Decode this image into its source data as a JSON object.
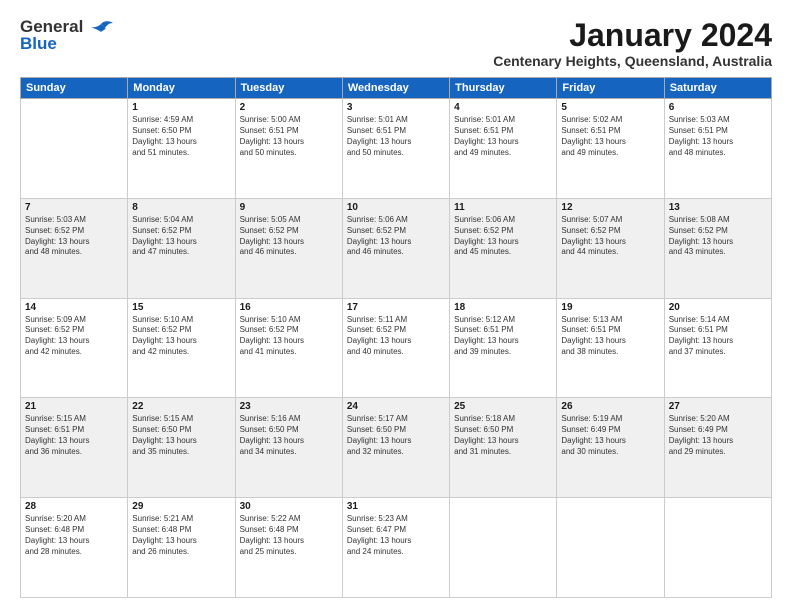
{
  "header": {
    "logo_general": "General",
    "logo_blue": "Blue",
    "title": "January 2024",
    "subtitle": "Centenary Heights, Queensland, Australia"
  },
  "days_of_week": [
    "Sunday",
    "Monday",
    "Tuesday",
    "Wednesday",
    "Thursday",
    "Friday",
    "Saturday"
  ],
  "weeks": [
    {
      "shaded": false,
      "days": [
        {
          "date": "",
          "info": ""
        },
        {
          "date": "1",
          "info": "Sunrise: 4:59 AM\nSunset: 6:50 PM\nDaylight: 13 hours\nand 51 minutes."
        },
        {
          "date": "2",
          "info": "Sunrise: 5:00 AM\nSunset: 6:51 PM\nDaylight: 13 hours\nand 50 minutes."
        },
        {
          "date": "3",
          "info": "Sunrise: 5:01 AM\nSunset: 6:51 PM\nDaylight: 13 hours\nand 50 minutes."
        },
        {
          "date": "4",
          "info": "Sunrise: 5:01 AM\nSunset: 6:51 PM\nDaylight: 13 hours\nand 49 minutes."
        },
        {
          "date": "5",
          "info": "Sunrise: 5:02 AM\nSunset: 6:51 PM\nDaylight: 13 hours\nand 49 minutes."
        },
        {
          "date": "6",
          "info": "Sunrise: 5:03 AM\nSunset: 6:51 PM\nDaylight: 13 hours\nand 48 minutes."
        }
      ]
    },
    {
      "shaded": true,
      "days": [
        {
          "date": "7",
          "info": "Sunrise: 5:03 AM\nSunset: 6:52 PM\nDaylight: 13 hours\nand 48 minutes."
        },
        {
          "date": "8",
          "info": "Sunrise: 5:04 AM\nSunset: 6:52 PM\nDaylight: 13 hours\nand 47 minutes."
        },
        {
          "date": "9",
          "info": "Sunrise: 5:05 AM\nSunset: 6:52 PM\nDaylight: 13 hours\nand 46 minutes."
        },
        {
          "date": "10",
          "info": "Sunrise: 5:06 AM\nSunset: 6:52 PM\nDaylight: 13 hours\nand 46 minutes."
        },
        {
          "date": "11",
          "info": "Sunrise: 5:06 AM\nSunset: 6:52 PM\nDaylight: 13 hours\nand 45 minutes."
        },
        {
          "date": "12",
          "info": "Sunrise: 5:07 AM\nSunset: 6:52 PM\nDaylight: 13 hours\nand 44 minutes."
        },
        {
          "date": "13",
          "info": "Sunrise: 5:08 AM\nSunset: 6:52 PM\nDaylight: 13 hours\nand 43 minutes."
        }
      ]
    },
    {
      "shaded": false,
      "days": [
        {
          "date": "14",
          "info": "Sunrise: 5:09 AM\nSunset: 6:52 PM\nDaylight: 13 hours\nand 42 minutes."
        },
        {
          "date": "15",
          "info": "Sunrise: 5:10 AM\nSunset: 6:52 PM\nDaylight: 13 hours\nand 42 minutes."
        },
        {
          "date": "16",
          "info": "Sunrise: 5:10 AM\nSunset: 6:52 PM\nDaylight: 13 hours\nand 41 minutes."
        },
        {
          "date": "17",
          "info": "Sunrise: 5:11 AM\nSunset: 6:52 PM\nDaylight: 13 hours\nand 40 minutes."
        },
        {
          "date": "18",
          "info": "Sunrise: 5:12 AM\nSunset: 6:51 PM\nDaylight: 13 hours\nand 39 minutes."
        },
        {
          "date": "19",
          "info": "Sunrise: 5:13 AM\nSunset: 6:51 PM\nDaylight: 13 hours\nand 38 minutes."
        },
        {
          "date": "20",
          "info": "Sunrise: 5:14 AM\nSunset: 6:51 PM\nDaylight: 13 hours\nand 37 minutes."
        }
      ]
    },
    {
      "shaded": true,
      "days": [
        {
          "date": "21",
          "info": "Sunrise: 5:15 AM\nSunset: 6:51 PM\nDaylight: 13 hours\nand 36 minutes."
        },
        {
          "date": "22",
          "info": "Sunrise: 5:15 AM\nSunset: 6:50 PM\nDaylight: 13 hours\nand 35 minutes."
        },
        {
          "date": "23",
          "info": "Sunrise: 5:16 AM\nSunset: 6:50 PM\nDaylight: 13 hours\nand 34 minutes."
        },
        {
          "date": "24",
          "info": "Sunrise: 5:17 AM\nSunset: 6:50 PM\nDaylight: 13 hours\nand 32 minutes."
        },
        {
          "date": "25",
          "info": "Sunrise: 5:18 AM\nSunset: 6:50 PM\nDaylight: 13 hours\nand 31 minutes."
        },
        {
          "date": "26",
          "info": "Sunrise: 5:19 AM\nSunset: 6:49 PM\nDaylight: 13 hours\nand 30 minutes."
        },
        {
          "date": "27",
          "info": "Sunrise: 5:20 AM\nSunset: 6:49 PM\nDaylight: 13 hours\nand 29 minutes."
        }
      ]
    },
    {
      "shaded": false,
      "days": [
        {
          "date": "28",
          "info": "Sunrise: 5:20 AM\nSunset: 6:48 PM\nDaylight: 13 hours\nand 28 minutes."
        },
        {
          "date": "29",
          "info": "Sunrise: 5:21 AM\nSunset: 6:48 PM\nDaylight: 13 hours\nand 26 minutes."
        },
        {
          "date": "30",
          "info": "Sunrise: 5:22 AM\nSunset: 6:48 PM\nDaylight: 13 hours\nand 25 minutes."
        },
        {
          "date": "31",
          "info": "Sunrise: 5:23 AM\nSunset: 6:47 PM\nDaylight: 13 hours\nand 24 minutes."
        },
        {
          "date": "",
          "info": ""
        },
        {
          "date": "",
          "info": ""
        },
        {
          "date": "",
          "info": ""
        }
      ]
    }
  ]
}
